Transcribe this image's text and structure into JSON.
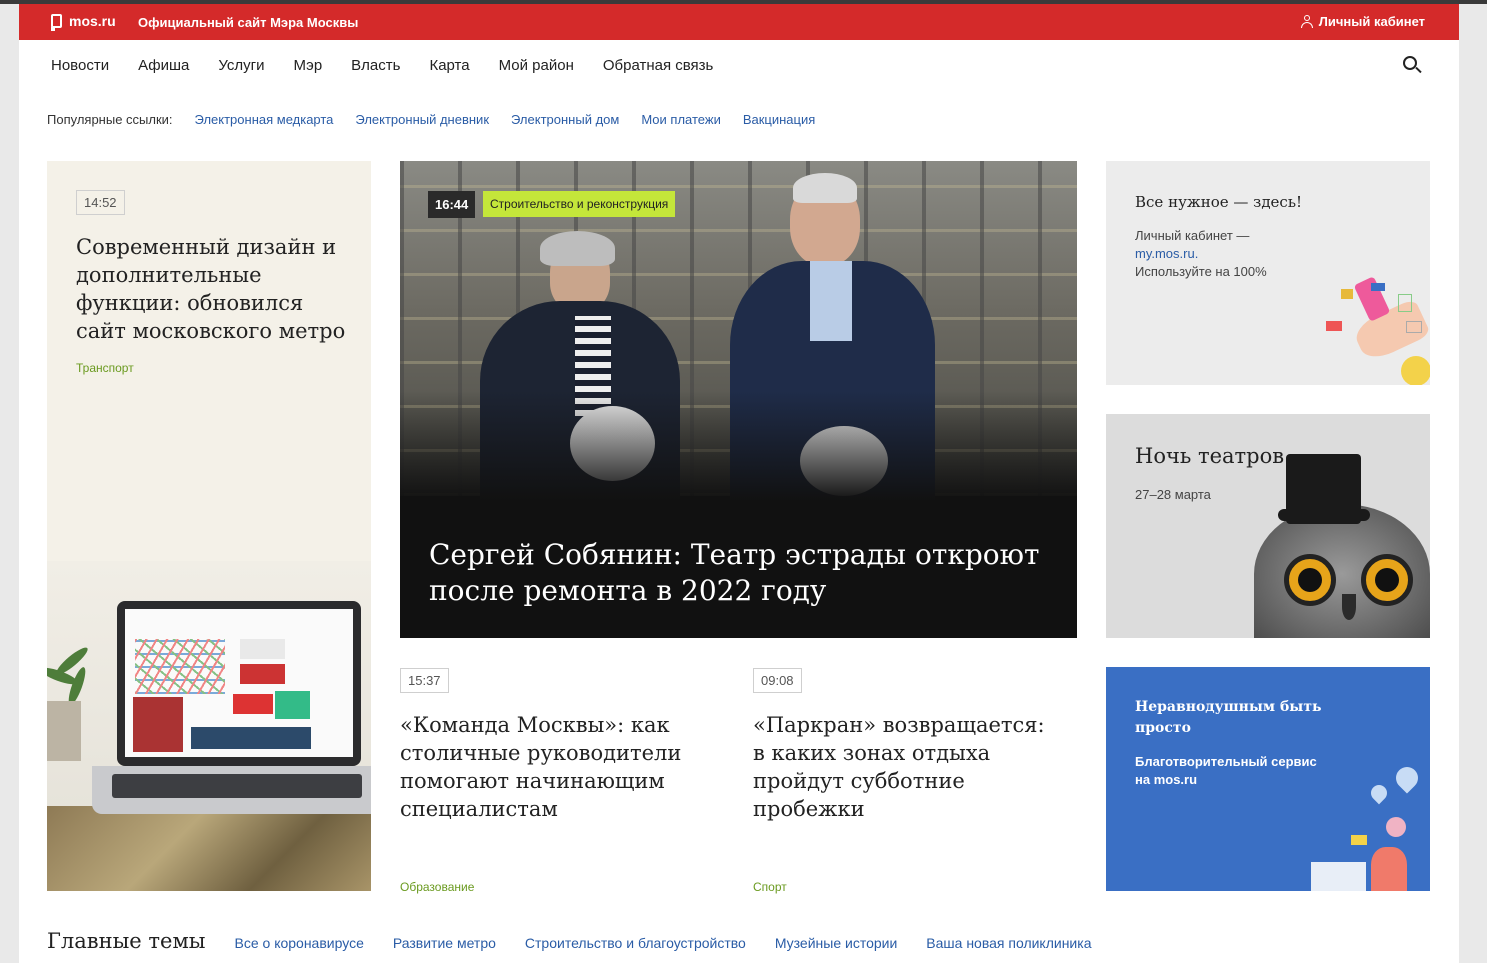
{
  "header": {
    "logo": "mos.ru",
    "site_title": "Официальный сайт Мэра Москвы",
    "cabinet": "Личный кабинет",
    "accent": "#d42a2a"
  },
  "nav": {
    "items": [
      "Новости",
      "Афиша",
      "Услуги",
      "Мэр",
      "Власть",
      "Карта",
      "Мой район",
      "Обратная связь"
    ],
    "search_icon": "search-icon"
  },
  "popular": {
    "label": "Популярные ссылки:",
    "links": [
      "Электронная медкарта",
      "Электронный дневник",
      "Электронный дом",
      "Мои платежи",
      "Вакцинация"
    ]
  },
  "left_card": {
    "time": "14:52",
    "title": "Современный дизайн и дополнительные функции: обновился сайт московского метро",
    "tag": "Транспорт"
  },
  "hero": {
    "time": "16:44",
    "category": "Строительство и реконструкция",
    "title": "Сергей Собянин: Театр эстрады откроют после ремонта в 2022 году"
  },
  "news": [
    {
      "time": "15:37",
      "title": "«Команда Москвы»: как столичные руководители помогают начинающим специалистам",
      "tag": "Образование"
    },
    {
      "time": "09:08",
      "title": "«Паркран» возвращается: в каких зонах отдыха пройдут субботние пробежки",
      "tag": "Спорт"
    }
  ],
  "right_cards": {
    "promo1": {
      "title": "Все нужное — здесь!",
      "line1": "Личный кабинет —",
      "link": "my.mos.ru.",
      "line2": "Используйте на 100%"
    },
    "promo2": {
      "title": "Ночь театров",
      "dates": "27–28 марта"
    },
    "promo3": {
      "title": "Неравнодушным быть просто",
      "subtitle": "Благотворительный сервис на mos.ru",
      "bg": "#3a6fc4"
    }
  },
  "topics": {
    "heading": "Главные темы",
    "links": [
      "Все о коронавирусе",
      "Развитие метро",
      "Строительство и благоустройство",
      "Музейные истории",
      "Ваша новая поликлиника"
    ]
  },
  "colors": {
    "link": "#2a5ca6",
    "tag": "#6a9a1f",
    "category_badge": "#c4e63a"
  }
}
